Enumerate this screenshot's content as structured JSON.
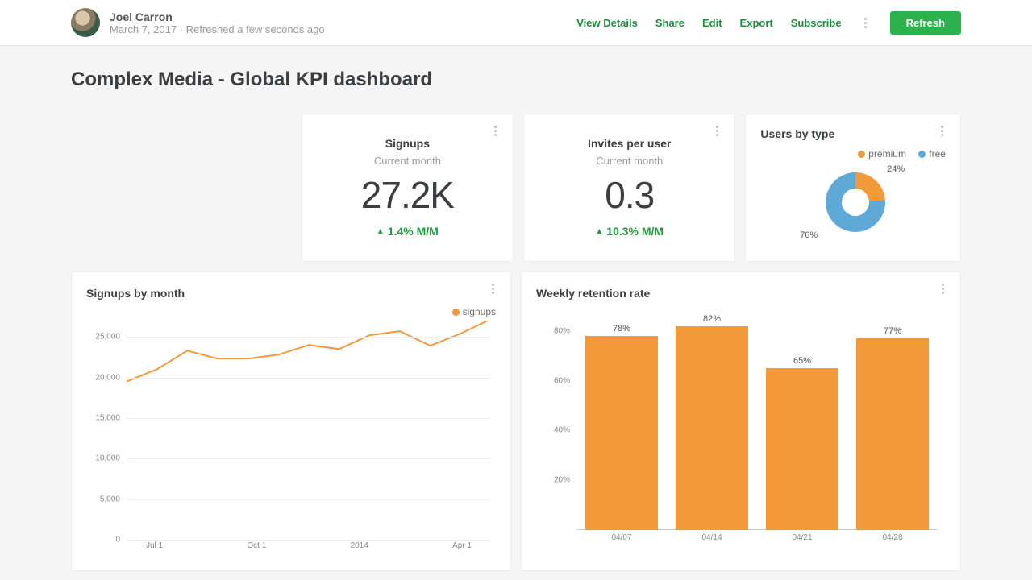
{
  "colors": {
    "accent_green": "#1f8d3d",
    "orange": "#f29a3a",
    "blue": "#5fa9d6"
  },
  "header": {
    "username": "Joel Carron",
    "meta": "March 7, 2017 · Refreshed a few seconds ago",
    "links": {
      "view_details": "View Details",
      "share": "Share",
      "edit": "Edit",
      "export": "Export",
      "subscribe": "Subscribe"
    },
    "refresh": "Refresh"
  },
  "page": {
    "title": "Complex Media - Global KPI dashboard"
  },
  "kpi_signups": {
    "title": "Signups",
    "subtitle": "Current month",
    "value": "27.2K",
    "delta": "1.4% M/M"
  },
  "kpi_invites": {
    "title": "Invites per user",
    "subtitle": "Current month",
    "value": "0.3",
    "delta": "10.3% M/M"
  },
  "users_by_type": {
    "title": "Users by type",
    "legend_premium": "premium",
    "legend_free": "free",
    "pct_premium": "24%",
    "pct_free": "76%"
  },
  "signups_by_month": {
    "title": "Signups by month",
    "legend": "signups"
  },
  "retention": {
    "title": "Weekly retention rate"
  },
  "chart_data": [
    {
      "id": "users_by_type_donut",
      "type": "pie",
      "title": "Users by type",
      "series": [
        {
          "name": "premium",
          "value": 24,
          "color": "#f29a3a"
        },
        {
          "name": "free",
          "value": 76,
          "color": "#5fa9d6"
        }
      ]
    },
    {
      "id": "signups_by_month_line",
      "type": "line",
      "title": "Signups by month",
      "xlabel": "",
      "ylabel": "",
      "ylim": [
        0,
        27000
      ],
      "y_ticks": [
        0,
        5000,
        10000,
        15000,
        20000,
        25000
      ],
      "y_tick_labels": [
        "0",
        "5,000",
        "10,000",
        "15,000",
        "20,000",
        "25,000"
      ],
      "x_tick_labels": [
        "Jul 1",
        "Oct 1",
        "2014",
        "Apr 1"
      ],
      "series": [
        {
          "name": "signups",
          "color": "#f29a3a",
          "x_index": [
            0,
            1,
            2,
            3,
            4,
            5,
            6,
            7,
            8,
            9,
            10,
            11
          ],
          "values": [
            19500,
            21000,
            23300,
            22300,
            22300,
            22800,
            24000,
            23500,
            25200,
            25700,
            23900,
            25400,
            27200
          ]
        }
      ]
    },
    {
      "id": "weekly_retention_bar",
      "type": "bar",
      "title": "Weekly retention rate",
      "ylim": [
        0,
        90
      ],
      "y_ticks": [
        20,
        40,
        60,
        80
      ],
      "y_tick_labels": [
        "20%",
        "40%",
        "60%",
        "80%"
      ],
      "categories": [
        "04/07",
        "04/14",
        "04/21",
        "04/28"
      ],
      "values": [
        78,
        82,
        65,
        77
      ],
      "value_labels": [
        "78%",
        "82%",
        "65%",
        "77%"
      ],
      "color": "#f29a3a"
    }
  ]
}
